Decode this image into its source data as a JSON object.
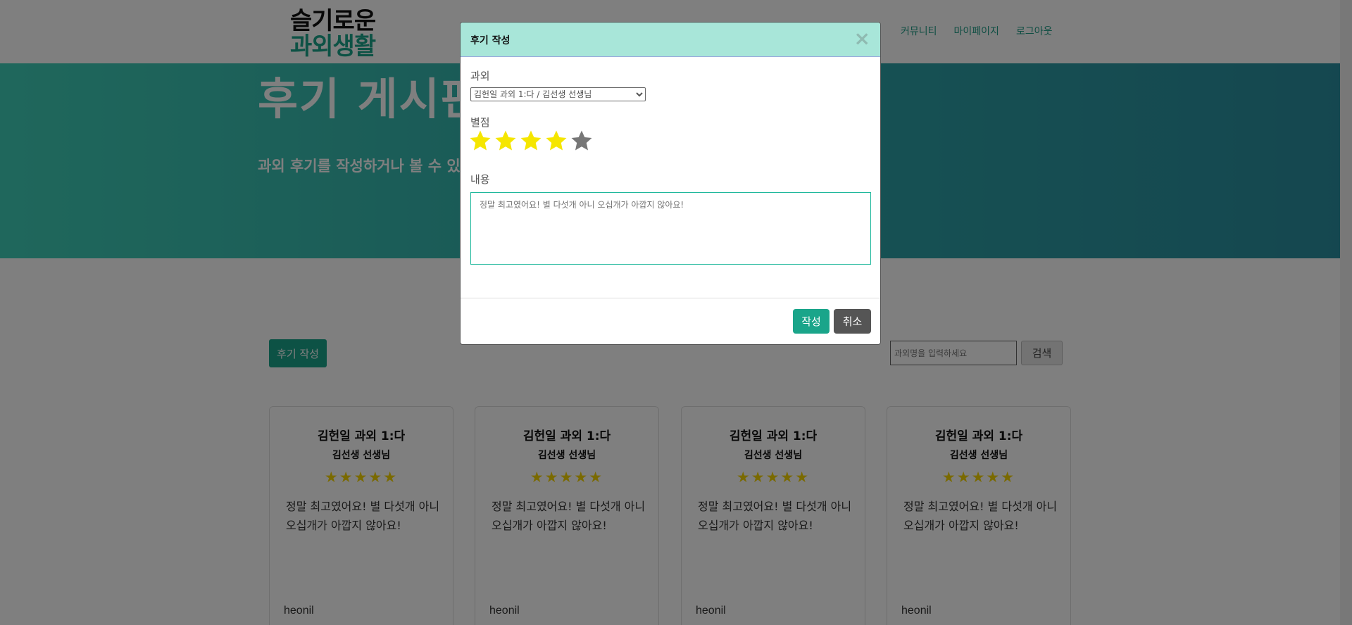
{
  "logo": {
    "line1": "슬기로운",
    "line2": "과외생활"
  },
  "nav": {
    "items": [
      "커뮤니티",
      "마이페이지",
      "로그아웃"
    ]
  },
  "hero": {
    "title": "후기 게시판",
    "subtitle": "과외 후기를 작성하거나 볼 수 있어요"
  },
  "toolbar": {
    "write_label": "후기 작성",
    "search_placeholder": "과외명을 입력하세요",
    "search_label": "검색"
  },
  "cards": [
    {
      "title": "김헌일 과외 1:다",
      "tutor": "김선생 선생님",
      "stars": "★★★★★",
      "text": "정말 최고였어요! 별 다섯개 아니 오십개가 아깝지 않아요!",
      "user": "heonil"
    },
    {
      "title": "김헌일 과외 1:다",
      "tutor": "김선생 선생님",
      "stars": "★★★★★",
      "text": "정말 최고였어요! 별 다섯개 아니 오십개가 아깝지 않아요!",
      "user": "heonil"
    },
    {
      "title": "김헌일 과외 1:다",
      "tutor": "김선생 선생님",
      "stars": "★★★★★",
      "text": "정말 최고였어요! 별 다섯개 아니 오십개가 아깝지 않아요!",
      "user": "heonil"
    },
    {
      "title": "김헌일 과외 1:다",
      "tutor": "김선생 선생님",
      "stars": "★★★★★",
      "text": "정말 최고였어요! 별 다섯개 아니 오십개가 아깝지 않아요!",
      "user": "heonil"
    }
  ],
  "modal": {
    "title": "후기 작성",
    "close": "×",
    "course_label": "과외",
    "course_selected": "김헌일 과외 1:다 / 김선생 선생님",
    "rating_label": "별점",
    "rating_value": 4,
    "rating_max": 5,
    "content_label": "내용",
    "content_placeholder": "정말 최고였어요! 별 다섯개 아니 오십개가 아깝지 않아요!",
    "submit_label": "작성",
    "cancel_label": "취소"
  },
  "colors": {
    "accent": "#1aa58a",
    "star_on": "#f5e600",
    "star_off": "#777777",
    "modal_header": "#a8e6d9"
  }
}
